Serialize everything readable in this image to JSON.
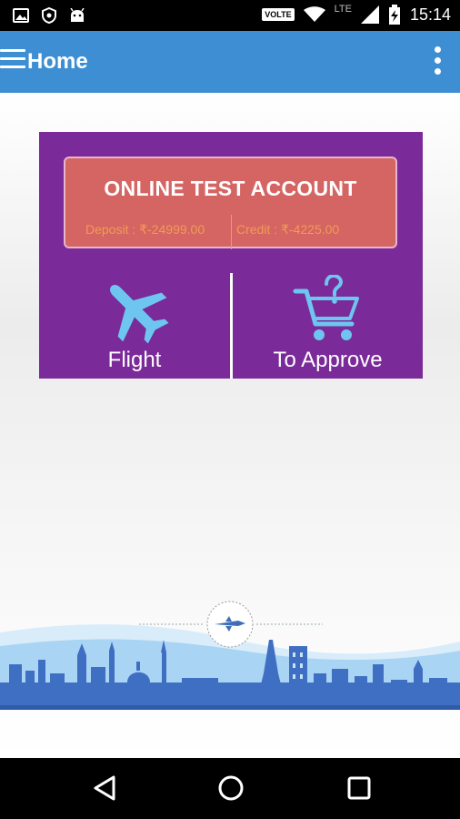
{
  "status_bar": {
    "time": "15:14",
    "network_badge": "VOLTE",
    "network_type": "LTE",
    "icons": [
      "image-icon",
      "shield-icon",
      "android-icon",
      "wifi-icon",
      "signal-icon",
      "battery-charging-icon"
    ]
  },
  "app_bar": {
    "title": "Home",
    "menu_icon": "hamburger-menu-icon",
    "overflow_icon": "more-vert-icon"
  },
  "account": {
    "name": "ONLINE TEST ACCOUNT",
    "deposit": "Deposit : ₹-24999.00",
    "credit": "Credit : ₹-4225.00"
  },
  "tiles": [
    {
      "label": "Flight",
      "icon": "airplane-icon"
    },
    {
      "label": "To Approve",
      "icon": "cart-question-icon"
    }
  ],
  "colors": {
    "app_bar": "#3d8ed2",
    "card": "#7b2a99",
    "account_box": "#d56563",
    "account_text": "#f29a55",
    "tile_icon": "#6ec6f0"
  },
  "nav_bar": {
    "icons": [
      "back-icon",
      "home-icon",
      "recents-icon"
    ]
  }
}
